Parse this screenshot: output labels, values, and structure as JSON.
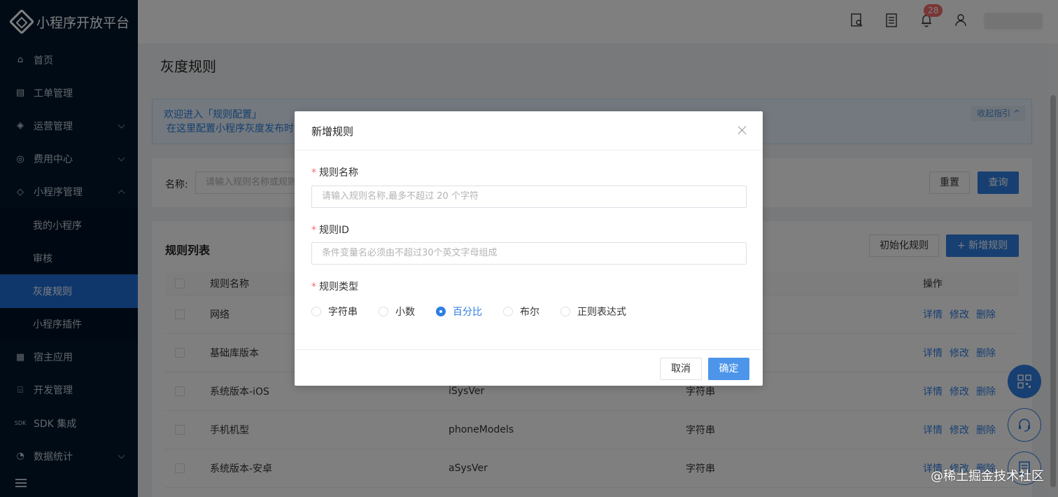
{
  "app": {
    "title": "小程序开放平台"
  },
  "sidebar": {
    "items": [
      {
        "label": "首页",
        "icon": "home-icon"
      },
      {
        "label": "工单管理",
        "icon": "ticket-icon"
      },
      {
        "label": "运营管理",
        "icon": "layers-icon",
        "expandable": true
      },
      {
        "label": "费用中心",
        "icon": "coin-icon",
        "expandable": true
      },
      {
        "label": "小程序管理",
        "icon": "miniapp-icon",
        "expanded": true
      },
      {
        "label": "我的小程序",
        "sub": true
      },
      {
        "label": "审核",
        "sub": true
      },
      {
        "label": "灰度规则",
        "sub": true,
        "active": true
      },
      {
        "label": "小程序插件",
        "sub": true
      },
      {
        "label": "宿主应用",
        "icon": "grid-icon"
      },
      {
        "label": "开发管理",
        "icon": "code-icon"
      },
      {
        "label": "SDK 集成",
        "icon": "sdk-icon"
      },
      {
        "label": "数据统计",
        "icon": "chart-icon",
        "expandable": true
      }
    ]
  },
  "header": {
    "notification_count": "28"
  },
  "page": {
    "title": "灰度规则"
  },
  "welcome": {
    "line1": "欢迎进入「规则配置」",
    "line2": "在这里配置小程序灰度发布时,",
    "toggle": "收起指引 ^"
  },
  "filter": {
    "name_label": "名称:",
    "name_placeholder": "请输入规则名称或规则",
    "reset": "重置",
    "search": "查询"
  },
  "list": {
    "title": "规则列表",
    "init_button": "初始化规则",
    "add_button": "+ 新增规则",
    "columns": {
      "name": "规则名称",
      "ops": "操作"
    },
    "op_labels": {
      "detail": "详情",
      "edit": "修改",
      "delete": "删除"
    },
    "rows": [
      {
        "name": "网络",
        "id": "",
        "type": ""
      },
      {
        "name": "基础库版本",
        "id": "",
        "type": ""
      },
      {
        "name": "系统版本-iOS",
        "id": "iSysVer",
        "type": "字符串"
      },
      {
        "name": "手机机型",
        "id": "phoneModels",
        "type": "字符串"
      },
      {
        "name": "系统版本-安卓",
        "id": "aSysVer",
        "type": "字符串"
      }
    ]
  },
  "modal": {
    "title": "新增规则",
    "name_label": "规则名称",
    "name_placeholder": "请输入规则名称,最多不超过 20 个字符",
    "id_label": "规则ID",
    "id_placeholder": "条件变量名必须由不超过30个英文字母组成",
    "type_label": "规则类型",
    "types": [
      "字符串",
      "小数",
      "百分比",
      "布尔",
      "正则表达式"
    ],
    "selected_type": "百分比",
    "cancel": "取消",
    "confirm": "确定"
  },
  "watermark": "@稀土掘金技术社区",
  "colors": {
    "primary": "#2f7ee5",
    "sidebar_bg": "#00162d",
    "danger": "#f56c6c"
  }
}
